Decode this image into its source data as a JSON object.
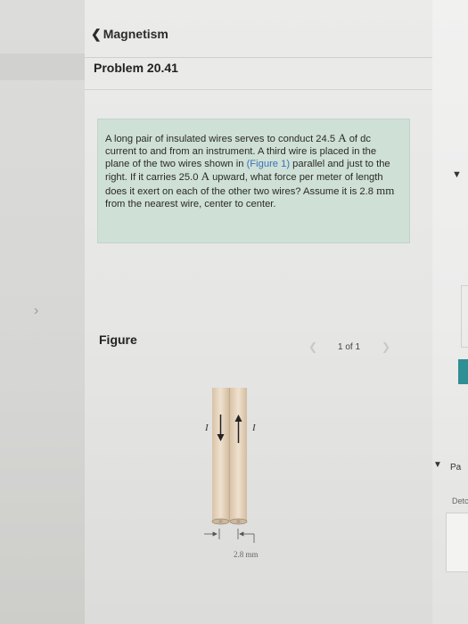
{
  "nav": {
    "back_label": "Magnetism"
  },
  "problem": {
    "title": "Problem 20.41",
    "text_parts": {
      "p1": "A long pair of insulated wires serves to conduct 24.5 ",
      "u1": "A",
      "p2": " of dc current to and from an instrument. A third wire is placed in the plane of the two wires shown in ",
      "link": "(Figure 1)",
      "p3": " parallel and just to the right. If it carries 25.0 ",
      "u2": "A",
      "p4": " upward, what force per meter of length does it exert on each of the other two wires? Assume it is 2.8 ",
      "u3": "mm",
      "p5": " from the nearest wire, center to center."
    }
  },
  "figure": {
    "label": "Figure",
    "pagination": "1 of 1",
    "prev_icon": "chevron-left-icon",
    "next_icon": "chevron-right-icon",
    "current_label_left": "I",
    "current_label_right": "I",
    "dimension_label": "2.8 mm"
  },
  "right_panel": {
    "part_label": "Pa",
    "detail_label": "Detc",
    "accent_color": "#2e8f94"
  },
  "colors": {
    "problem_box_bg": "#cfe0d6",
    "link": "#3b73b8",
    "wire_fill": "#e6d3bd"
  }
}
